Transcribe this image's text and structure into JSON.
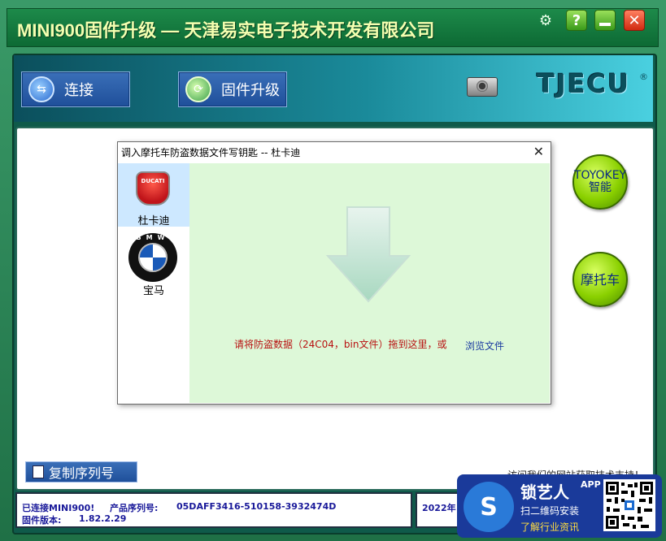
{
  "window": {
    "title": "MINI900固件升级 — 天津易实电子技术开发有限公司",
    "help_glyph": "?",
    "close_glyph": "✕",
    "gear_glyph": "⚙"
  },
  "toolbar": {
    "connect_label": "连接",
    "firmware_label": "固件升级",
    "logo_text": "TJECU",
    "logo_mark": "®"
  },
  "side_buttons": {
    "toyoke_label": "TOYOKEY智能",
    "moto_label": "摩托车"
  },
  "dialog": {
    "title": "调入摩托车防盗数据文件写钥匙 -- 杜卡迪",
    "close_glyph": "✕",
    "brands": [
      {
        "label": "杜卡迪",
        "logo_text": "DUCATI",
        "selected": true
      },
      {
        "label": "宝马",
        "logo_text": "BMW",
        "selected": false
      }
    ],
    "drop_text": "请将防盗数据（24C04，bin文件）拖到这里，或",
    "browse_link": "浏览文件"
  },
  "bottom": {
    "copy_button": "复制序列号",
    "visit_text": "访问我们的网站获取技术支持！"
  },
  "status": {
    "connected": "已连接MINI900!",
    "serial_label": "产品序列号:",
    "serial_value": "05DAFF3416-510158-3932474D",
    "version_label": "固件版本:",
    "version_value": "1.82.2.29",
    "date_partial": "2022年"
  },
  "watermark": {
    "brand": "锁艺人",
    "app": "APP",
    "line1": "扫二维码安装",
    "line2": "了解行业资讯",
    "logo_glyph": "S"
  },
  "colors": {
    "title_text": "#f4ffb0",
    "accent_green": "#8ad000",
    "drop_zone": "#ddf8d8",
    "status_text": "#1a1a9a",
    "error_text": "#b81010"
  }
}
